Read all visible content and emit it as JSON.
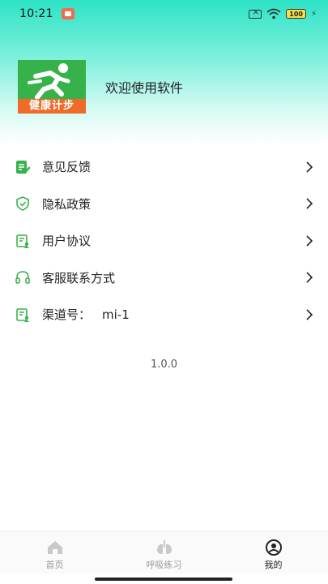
{
  "status_bar": {
    "time": "10:21",
    "battery": "100"
  },
  "profile": {
    "logo_text": "健康计步",
    "welcome": "欢迎使用软件"
  },
  "menu": [
    {
      "label": "意见反馈",
      "icon": "feedback-icon"
    },
    {
      "label": "隐私政策",
      "icon": "shield-icon"
    },
    {
      "label": "用户协议",
      "icon": "agreement-icon"
    },
    {
      "label": "客服联系方式",
      "icon": "headset-icon"
    },
    {
      "label": "渠道号：",
      "value": "mi-1",
      "icon": "channel-icon"
    }
  ],
  "version": "1.0.0",
  "tabbar": {
    "items": [
      {
        "label": "首页",
        "icon": "home-icon"
      },
      {
        "label": "呼吸练习",
        "icon": "lungs-icon"
      },
      {
        "label": "我的",
        "icon": "profile-icon"
      }
    ],
    "active_index": 2
  },
  "colors": {
    "accent": "#37b24a",
    "header": "#2de3c6",
    "logo_band": "#f06a2a"
  }
}
